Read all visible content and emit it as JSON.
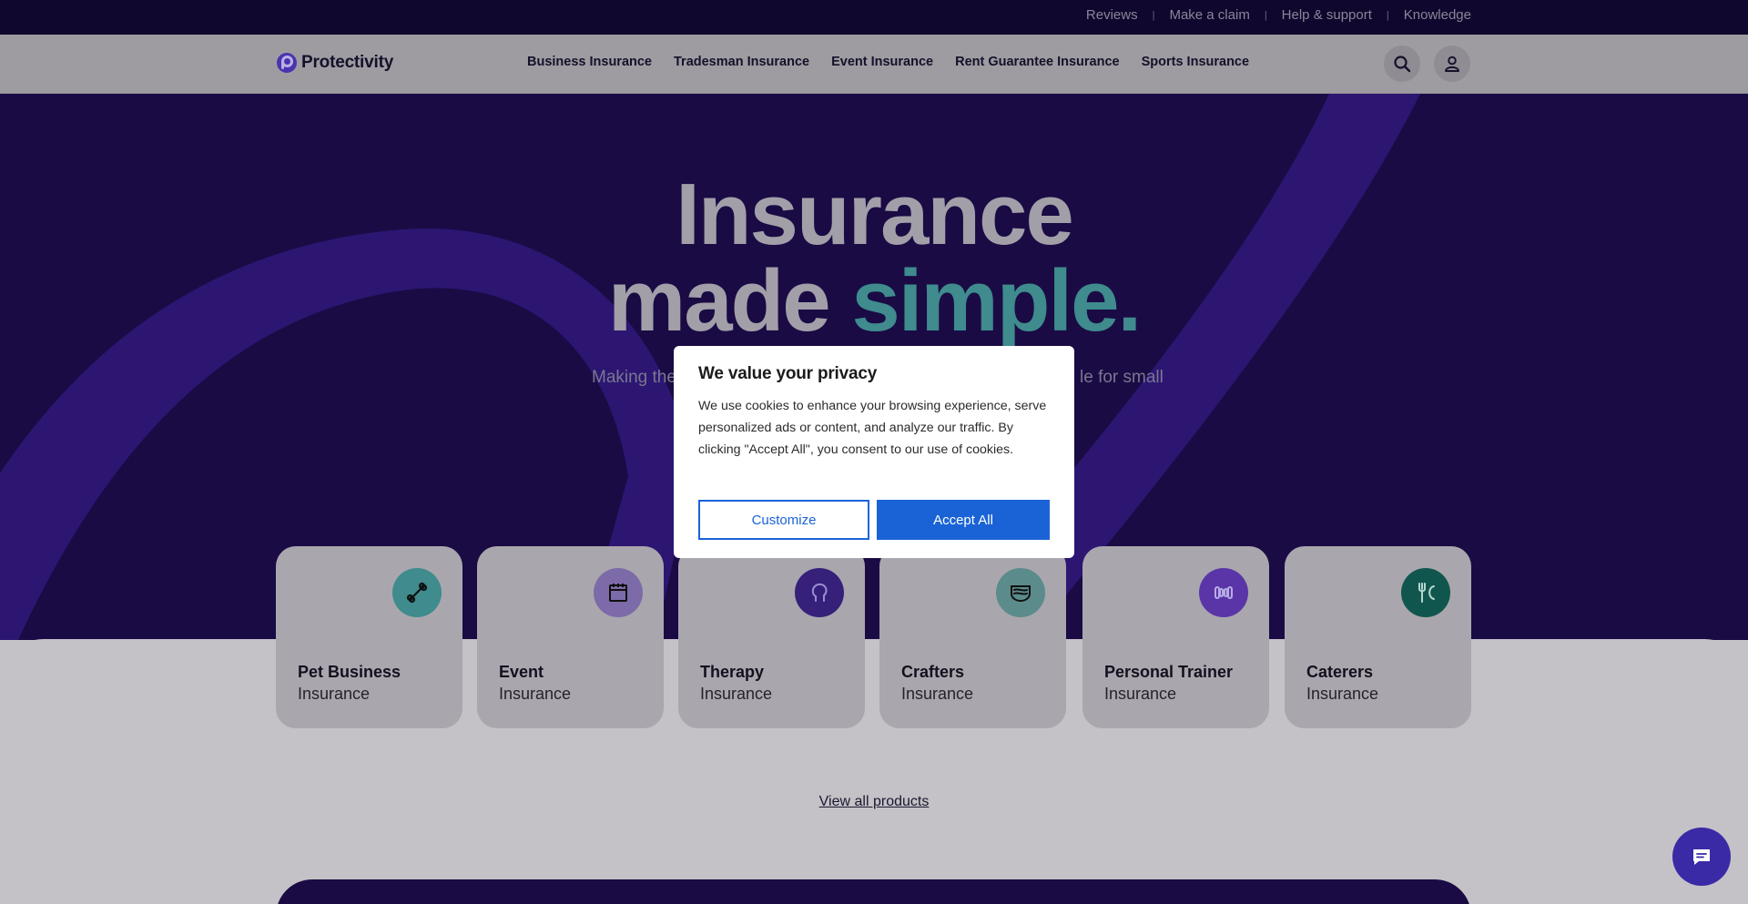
{
  "topbar": {
    "links": [
      "Reviews",
      "Make a claim",
      "Help & support",
      "Knowledge"
    ],
    "separator": "|"
  },
  "nav": {
    "brand": "Protectivity",
    "links": [
      "Business Insurance",
      "Tradesman Insurance",
      "Event Insurance",
      "Rent Guarantee Insurance",
      "Sports Insurance"
    ],
    "search_icon": "search-icon",
    "account_icon": "user-icon"
  },
  "hero": {
    "line1": "Insurance",
    "line2_a": "made ",
    "line2_b": "simple.",
    "sub_left": "Making the",
    "sub_right": "le for small"
  },
  "cards": [
    {
      "title": "Pet Business",
      "sub": "Insurance",
      "icon": "bone-icon",
      "color": "#3f8b8d"
    },
    {
      "title": "Event",
      "sub": "Insurance",
      "icon": "calendar-icon",
      "color": "#7d6aa8"
    },
    {
      "title": "Therapy",
      "sub": "Insurance",
      "icon": "head-icon",
      "color": "#36207a"
    },
    {
      "title": "Crafters",
      "sub": "Insurance",
      "icon": "fabric-icon",
      "color": "#5c8b8c"
    },
    {
      "title": "Personal Trainer",
      "sub": "Insurance",
      "icon": "dumbbell-icon",
      "color": "#5a35a8"
    },
    {
      "title": "Caterers",
      "sub": "Insurance",
      "icon": "cutlery-icon",
      "color": "#10564e"
    }
  ],
  "view_all": "View all products",
  "cookie": {
    "title": "We value your privacy",
    "body": "We use cookies to enhance your browsing experience, serve personalized ads or content, and analyze our traffic. By clicking \"Accept All\", you consent to our use of cookies.",
    "customize": "Customize",
    "accept": "Accept All"
  },
  "chat_icon": "chat-icon",
  "colors": {
    "hero_bg": "#1a0b45",
    "accent_teal": "#3f8b8d",
    "primary_blue": "#1a63d6"
  }
}
